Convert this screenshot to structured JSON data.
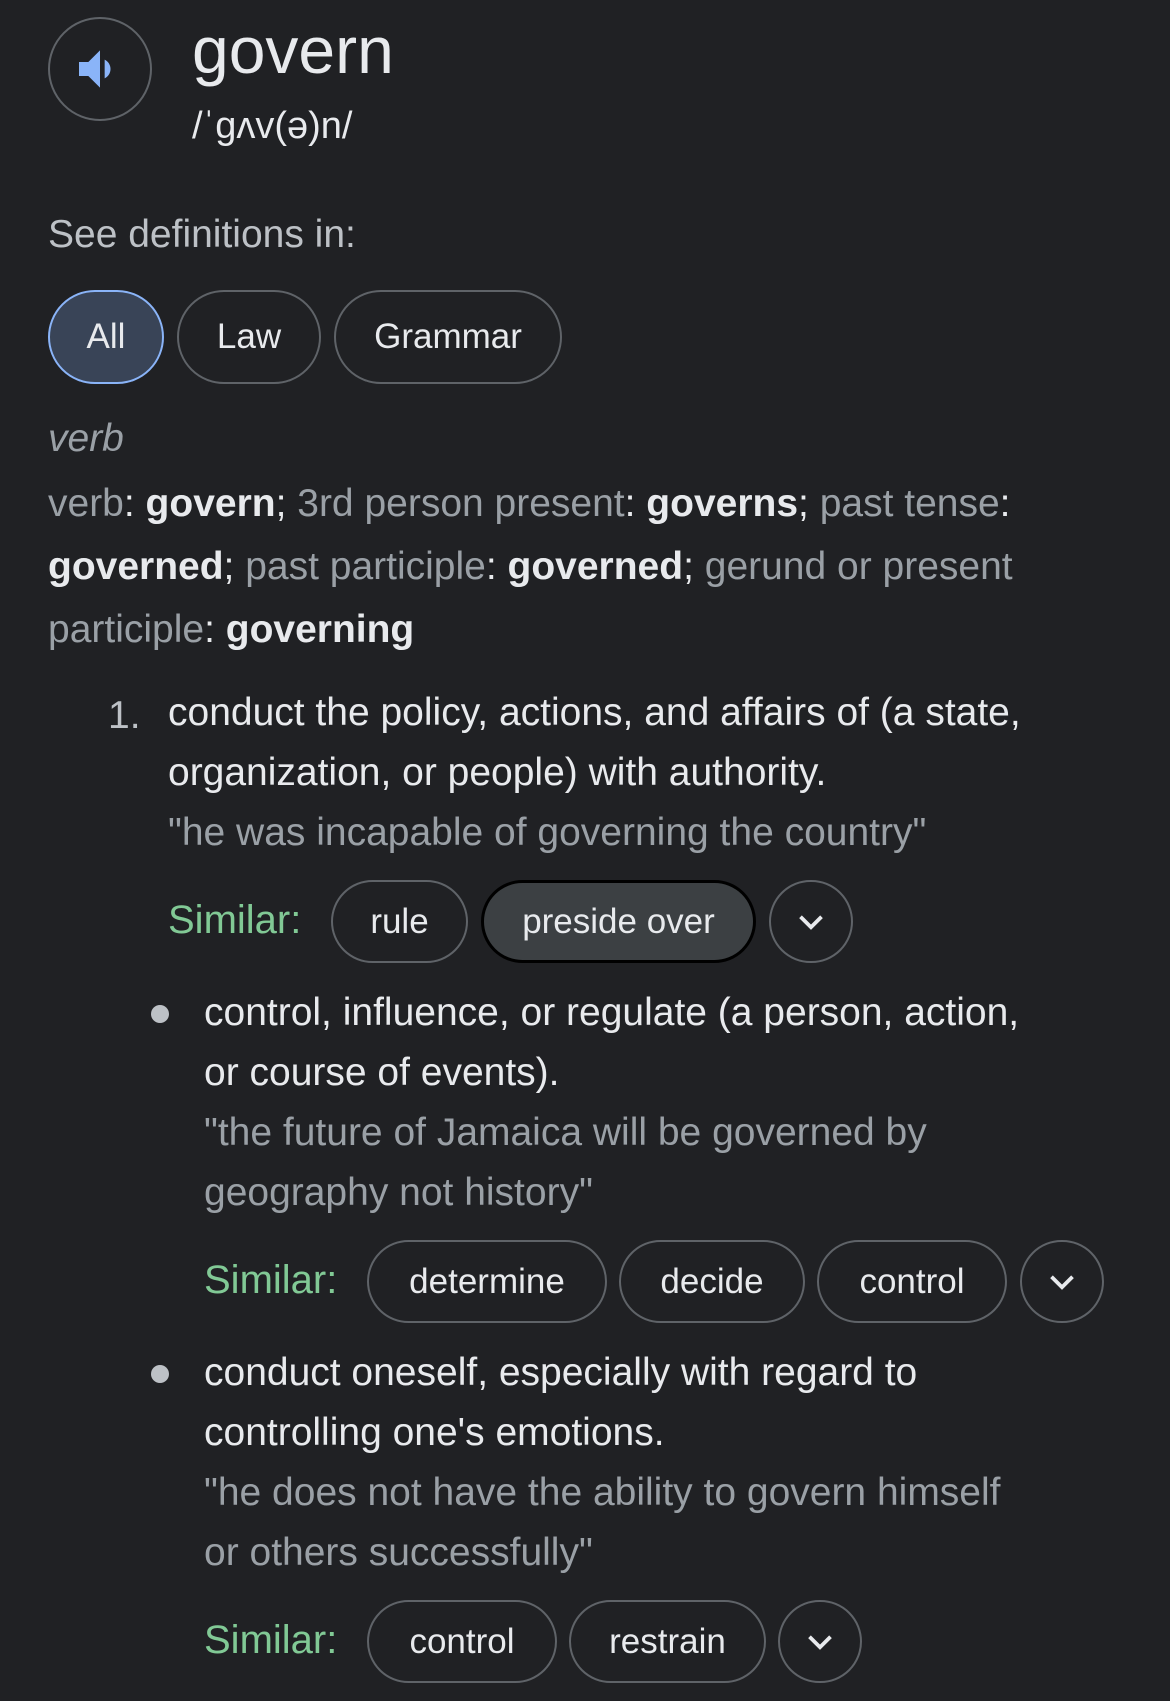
{
  "header": {
    "word": "govern",
    "phonetic": "/ˈɡʌv(ə)n/",
    "speaker_icon": "speaker-icon"
  },
  "filters": {
    "label": "See definitions in:",
    "chips": [
      "All",
      "Law",
      "Grammar"
    ],
    "selected": "All"
  },
  "entry": {
    "part_of_speech": "verb",
    "forms": [
      {
        "label": "verb",
        "value": "govern"
      },
      {
        "label": "3rd person present",
        "value": "governs"
      },
      {
        "label": "past tense",
        "value": "governed"
      },
      {
        "label": "past participle",
        "value": "governed"
      },
      {
        "label": "gerund or present participle",
        "value": "governing"
      }
    ]
  },
  "senses": [
    {
      "number": "1.",
      "definition_lines": [
        "conduct the policy, actions, and affairs of (a state,",
        "organization, or people) with authority."
      ],
      "example_lines": [
        "\"he was incapable of governing the country\""
      ],
      "similar_label": "Similar:",
      "similar": [
        "rule",
        "preside over"
      ]
    },
    {
      "definition_lines": [
        "control, influence, or regulate (a person, action,",
        "or course of events)."
      ],
      "example_lines": [
        "\"the future of Jamaica will be governed by",
        "geography not history\""
      ],
      "similar_label": "Similar:",
      "similar": [
        "determine",
        "decide",
        "control"
      ]
    },
    {
      "definition_lines": [
        "conduct oneself, especially with regard to",
        "controlling one's emotions."
      ],
      "example_lines": [
        "\"he does not have the ability to govern himself",
        "or others successfully\""
      ],
      "similar_label": "Similar:",
      "similar": [
        "control",
        "restrain"
      ]
    }
  ],
  "colors": {
    "background": "#202124",
    "similar_label": "#81c995",
    "selected_chip": "#394457",
    "accent": "#8ab4f8"
  }
}
